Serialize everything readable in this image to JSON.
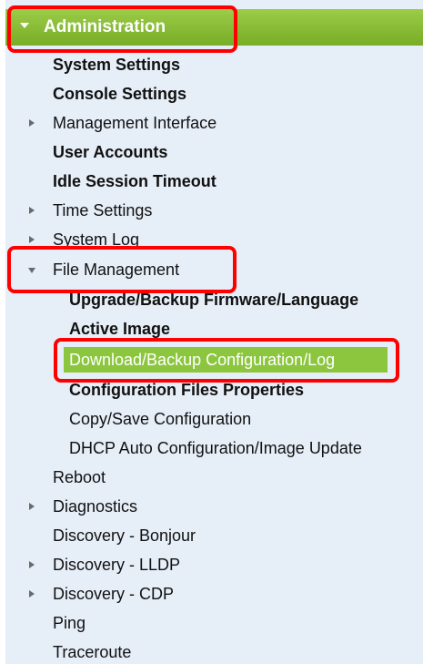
{
  "menu": {
    "header": "Administration",
    "items": [
      {
        "label": "System Settings"
      },
      {
        "label": "Console Settings"
      },
      {
        "label": "Management Interface"
      },
      {
        "label": "User Accounts"
      },
      {
        "label": "Idle Session Timeout"
      },
      {
        "label": "Time Settings"
      },
      {
        "label": "System Log"
      },
      {
        "label": "File Management"
      },
      {
        "label": "Upgrade/Backup Firmware/Language"
      },
      {
        "label": "Active Image"
      },
      {
        "label": "Download/Backup Configuration/Log"
      },
      {
        "label": "Configuration Files Properties"
      },
      {
        "label": "Copy/Save Configuration"
      },
      {
        "label": "DHCP Auto Configuration/Image Update"
      },
      {
        "label": "Reboot"
      },
      {
        "label": "Diagnostics"
      },
      {
        "label": "Discovery - Bonjour"
      },
      {
        "label": "Discovery - LLDP"
      },
      {
        "label": "Discovery - CDP"
      },
      {
        "label": "Ping"
      },
      {
        "label": "Traceroute"
      }
    ]
  },
  "colors": {
    "header_bg": "#8cc63f",
    "selected_bg": "#8cc63f",
    "panel_bg": "#e6eef8",
    "highlight_border": "#ff0000"
  }
}
